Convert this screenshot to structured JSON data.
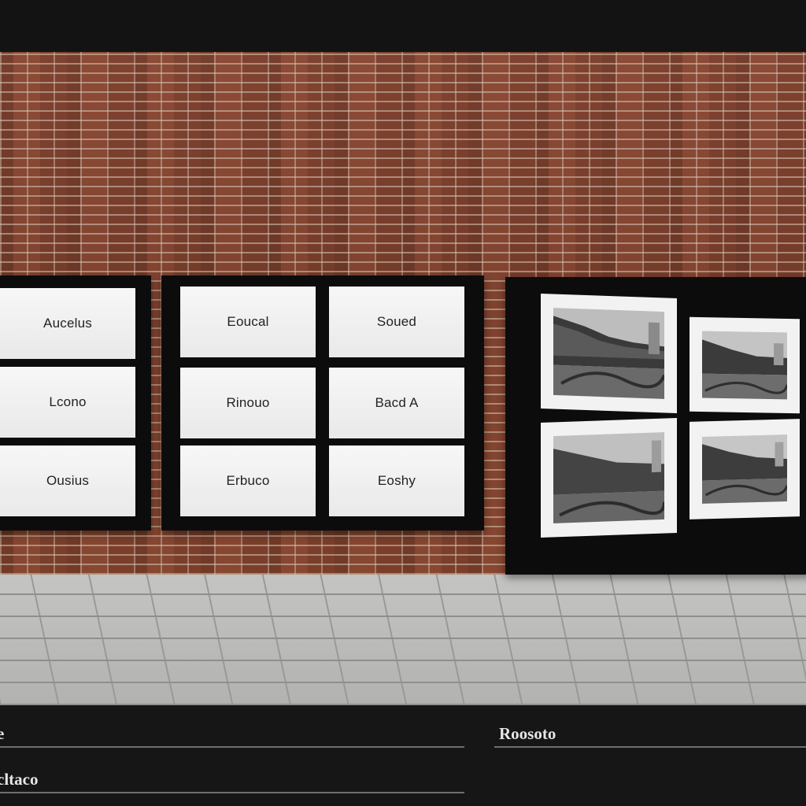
{
  "left_board": {
    "cards": [
      "Aucelus",
      "Lcono",
      "Ousius"
    ]
  },
  "middle_board": {
    "cards": [
      "Eoucal",
      "Soued",
      "Rinouo",
      "Bacd A",
      "Erbuco",
      "Eoshy"
    ]
  },
  "right_board": {
    "photos": [
      "gallery-photo",
      "gallery-photo",
      "gallery-photo",
      "gallery-photo"
    ]
  },
  "bottom": {
    "left_label_1": "e",
    "left_label_2": "cltaco",
    "right_label": "Roosoto"
  },
  "colors": {
    "brick": "#7e4331",
    "board": "#0c0c0c",
    "card": "#f3f3f3",
    "pavement": "#b9b9b7",
    "panel": "#161616"
  }
}
